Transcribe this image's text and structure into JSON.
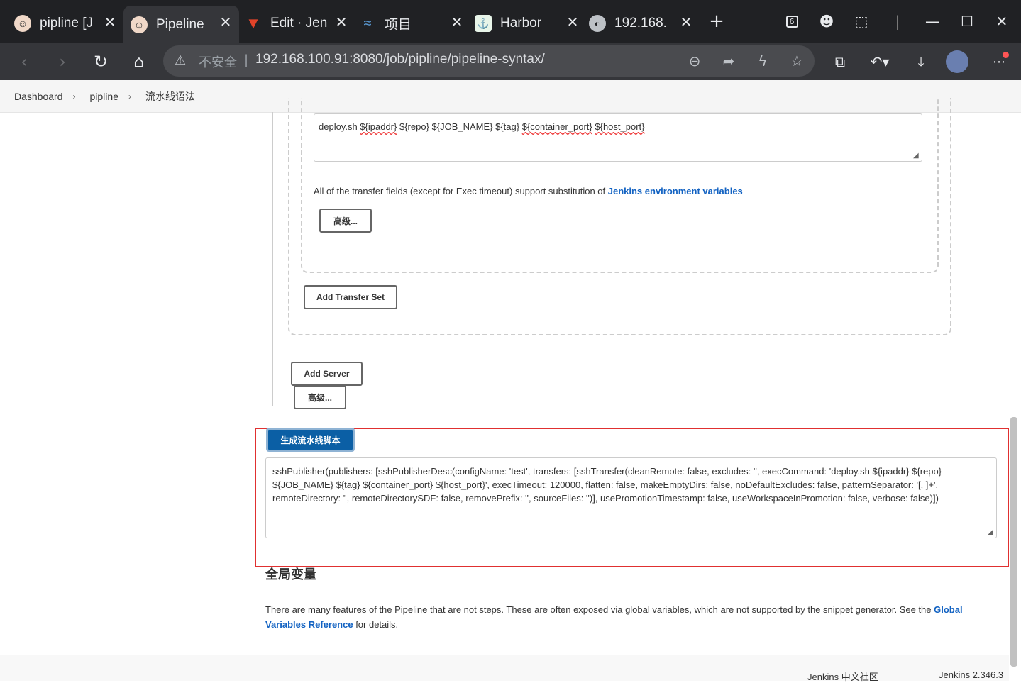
{
  "browser": {
    "tabs": [
      {
        "title": "pipline [J",
        "icon": "jenkins-icon"
      },
      {
        "title": "Pipeline",
        "icon": "jenkins-icon"
      },
      {
        "title": "Edit · Jen",
        "icon": "gitlab-icon"
      },
      {
        "title": "项目",
        "icon": "project-icon"
      },
      {
        "title": "Harbor",
        "icon": "harbor-icon"
      },
      {
        "title": "192.168.",
        "icon": "globe-icon"
      }
    ],
    "badge_count": "6",
    "security_label": "不安全",
    "url": "192.168.100.91:8080/job/pipline/pipeline-syntax/"
  },
  "breadcrumb": {
    "items": [
      "Dashboard",
      "pipline",
      "流水线语法"
    ]
  },
  "form": {
    "exec_command": {
      "prefix": "deploy.sh ",
      "ipaddr": "${ipaddr}",
      "middle": " ${repo} ${JOB_NAME} ${tag} ",
      "container_port": "${container_port}",
      "space": " ",
      "host_port": "${host_port}"
    },
    "transfer_note": "All of the transfer fields (except for Exec timeout) support substitution of ",
    "transfer_note_link": "Jenkins environment variables",
    "advanced_label_inner": "高级...",
    "add_transfer_set_label": "Add Transfer Set",
    "add_server_label": "Add Server",
    "advanced_label_outer": "高级..."
  },
  "generator": {
    "button_label": "生成流水线脚本",
    "script": "sshPublisher(publishers: [sshPublisherDesc(configName: 'test', transfers: [sshTransfer(cleanRemote: false, excludes: '', execCommand: 'deploy.sh ${ipaddr} ${repo} ${JOB_NAME} ${tag} ${container_port} ${host_port}', execTimeout: 120000, flatten: false, makeEmptyDirs: false, noDefaultExcludes: false, patternSeparator: '[, ]+', remoteDirectory: '', remoteDirectorySDF: false, removePrefix: '', sourceFiles: '')], usePromotionTimestamp: false, useWorkspaceInPromotion: false, verbose: false)])"
  },
  "global_vars": {
    "heading": "全局变量",
    "text": "There are many features of the Pipeline that are not steps. These are often exposed via global variables, which are not supported by the snippet generator. See the ",
    "link": "Global Variables Reference",
    "text_after": " for details."
  },
  "footer": {
    "community": "Jenkins 中文社区",
    "version": "Jenkins 2.346.3"
  },
  "colors": {
    "highlight_border": "#e03030",
    "primary_button": "#0b5fa5",
    "link": "#1262c2"
  }
}
